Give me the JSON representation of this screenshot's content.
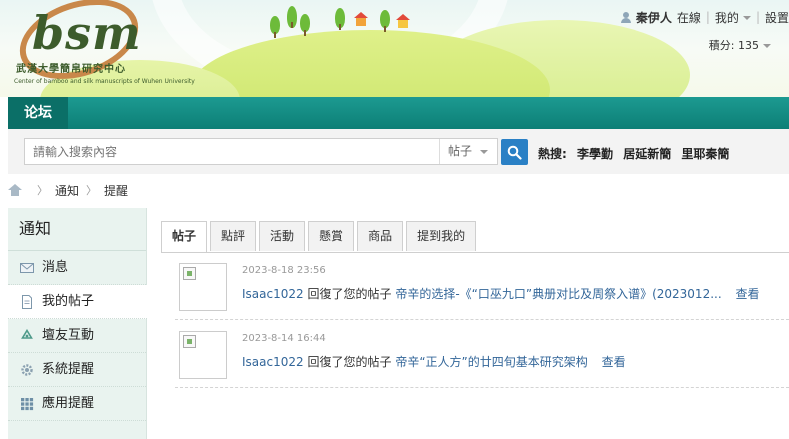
{
  "logo": {
    "text": "bsm",
    "cn": "武漢大學簡帛研究中心",
    "en": "Center of bamboo and silk manuscripts of Wuhen University"
  },
  "user": {
    "name": "秦伊人",
    "status": "在線",
    "my": "我的",
    "settings": "設置",
    "credits": "積分: 135"
  },
  "nav": {
    "forum": "论坛"
  },
  "search": {
    "placeholder": "請輸入搜索內容",
    "type": "帖子",
    "hot_label": "熱搜:",
    "hot": [
      "李學勤",
      "居延新簡",
      "里耶秦簡"
    ]
  },
  "breadcrumb": [
    "通知",
    "提醒"
  ],
  "sidebar": {
    "title": "通知",
    "items": [
      {
        "label": "消息",
        "icon": "envelope-icon"
      },
      {
        "label": "我的帖子",
        "icon": "document-icon"
      },
      {
        "label": "壇友互動",
        "icon": "recycle-icon"
      },
      {
        "label": "系統提醒",
        "icon": "gear-icon"
      },
      {
        "label": "應用提醒",
        "icon": "grid-icon"
      }
    ]
  },
  "tabs": [
    "帖子",
    "點評",
    "活動",
    "懸賞",
    "商品",
    "提到我的"
  ],
  "notices": [
    {
      "time": "2023-8-18 23:56",
      "user": "Isaac1022",
      "action": "回復了您的帖子",
      "title": "帝辛的选择-《“口巫九口”典册对比及周祭入谱》(2023012...",
      "view": "查看"
    },
    {
      "time": "2023-8-14 16:44",
      "user": "Isaac1022",
      "action": "回復了您的帖子",
      "title": "帝辛“正人方”的廿四旬基本研究架构",
      "view": "查看"
    }
  ],
  "colors": {
    "nav": "#0d7f76",
    "link": "#336699",
    "search_button": "#2a80c5"
  }
}
